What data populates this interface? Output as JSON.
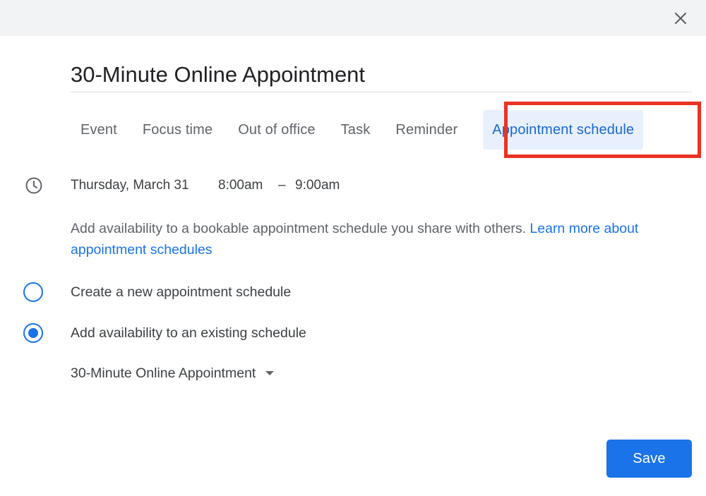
{
  "dialog": {
    "close_icon": "close-icon"
  },
  "title": {
    "value": "30-Minute Online Appointment"
  },
  "tabs": [
    {
      "label": "Event",
      "active": false
    },
    {
      "label": "Focus time",
      "active": false
    },
    {
      "label": "Out of office",
      "active": false
    },
    {
      "label": "Task",
      "active": false
    },
    {
      "label": "Reminder",
      "active": false
    },
    {
      "label": "Appointment schedule",
      "active": true
    }
  ],
  "time": {
    "icon": "clock-icon",
    "date": "Thursday, March 31",
    "start": "8:00am",
    "separator": "–",
    "end": "9:00am"
  },
  "description": {
    "text": "Add availability to a bookable appointment schedule you share with others. ",
    "link": "Learn more about appointment schedules"
  },
  "options": [
    {
      "label": "Create a new appointment schedule",
      "selected": false
    },
    {
      "label": "Add availability to an existing schedule",
      "selected": true
    }
  ],
  "schedule_select": {
    "value": "30-Minute Online Appointment"
  },
  "actions": {
    "save_label": "Save"
  },
  "colors": {
    "accent": "#1a73e8",
    "active_tab_bg": "#e8f0fe",
    "highlight": "#ea3323",
    "topbar": "#f1f3f4"
  }
}
